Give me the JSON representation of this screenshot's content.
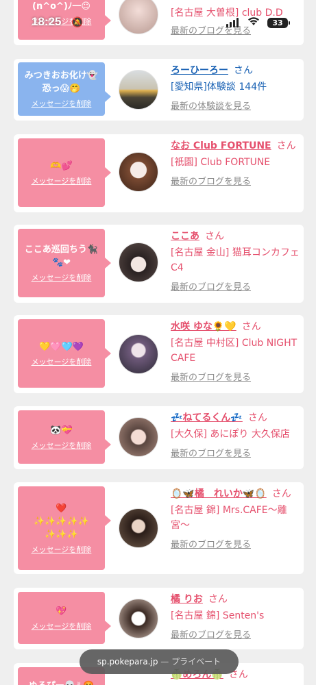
{
  "status_bar": {
    "time": "18:25",
    "battery": "33"
  },
  "url_bar": {
    "domain": "sp.pokepara.jp",
    "separator": " — ",
    "mode": "プライベート"
  },
  "delete_label": "メッセージを削除",
  "san_label": "さん",
  "top_partial": {
    "message": "(n^o^)ﾉ一☺",
    "detail": "[名古屋 大曽根] club D.D",
    "link": "最新のブログを見る"
  },
  "cards": [
    {
      "message": "みつきおお化け👻\n恐っ😱🤭",
      "name": "ろーひーろー",
      "detail": "[愛知県]体験談 144件",
      "link": "最新の体験談を見る"
    },
    {
      "message": "🫶💕",
      "name": "なお Club FORTUNE",
      "detail": "[祇園] Club FORTUNE",
      "link": "最新のブログを見る"
    },
    {
      "message": "ここあ巡回ちう🐈‍⬛\n🐾❤",
      "name": "ここあ",
      "detail": "[名古屋 金山] 猫耳コンカフェ C4",
      "link": "最新のブログを見る"
    },
    {
      "message": "💛🩷🩵💜",
      "name": "水咲 ゆな🌻💛",
      "detail": "[名古屋 中村区] Club NIGHT CAFE",
      "link": "最新のブログを見る"
    },
    {
      "message": "🐼💝",
      "name": "💤ねてるくん💤",
      "detail": "[大久保] あにぽり 大久保店",
      "link": "最新のブログを見る"
    },
    {
      "message": "❤️\n✨✨✨✨✨\n✨✨✨",
      "name": "🪞🦋橘　れいか🦋🪞",
      "detail": "[名古屋 錦] Mrs.CAFE〜離宮〜",
      "link": "最新のブログを見る"
    },
    {
      "message": "💖",
      "name": "橘 りお",
      "detail": "[名古屋 錦] Senten's",
      "link": "最新のブログを見る"
    }
  ],
  "bottom_partial": {
    "message": "ぬるぴー💀✌🤬",
    "name": "🍈めろん🍈"
  },
  "colors": {
    "pink_bubble": "#f58ea3",
    "blue_bubble": "#8ab4ee",
    "name_pink": "#e5506d",
    "name_blue": "#1a62b4"
  }
}
